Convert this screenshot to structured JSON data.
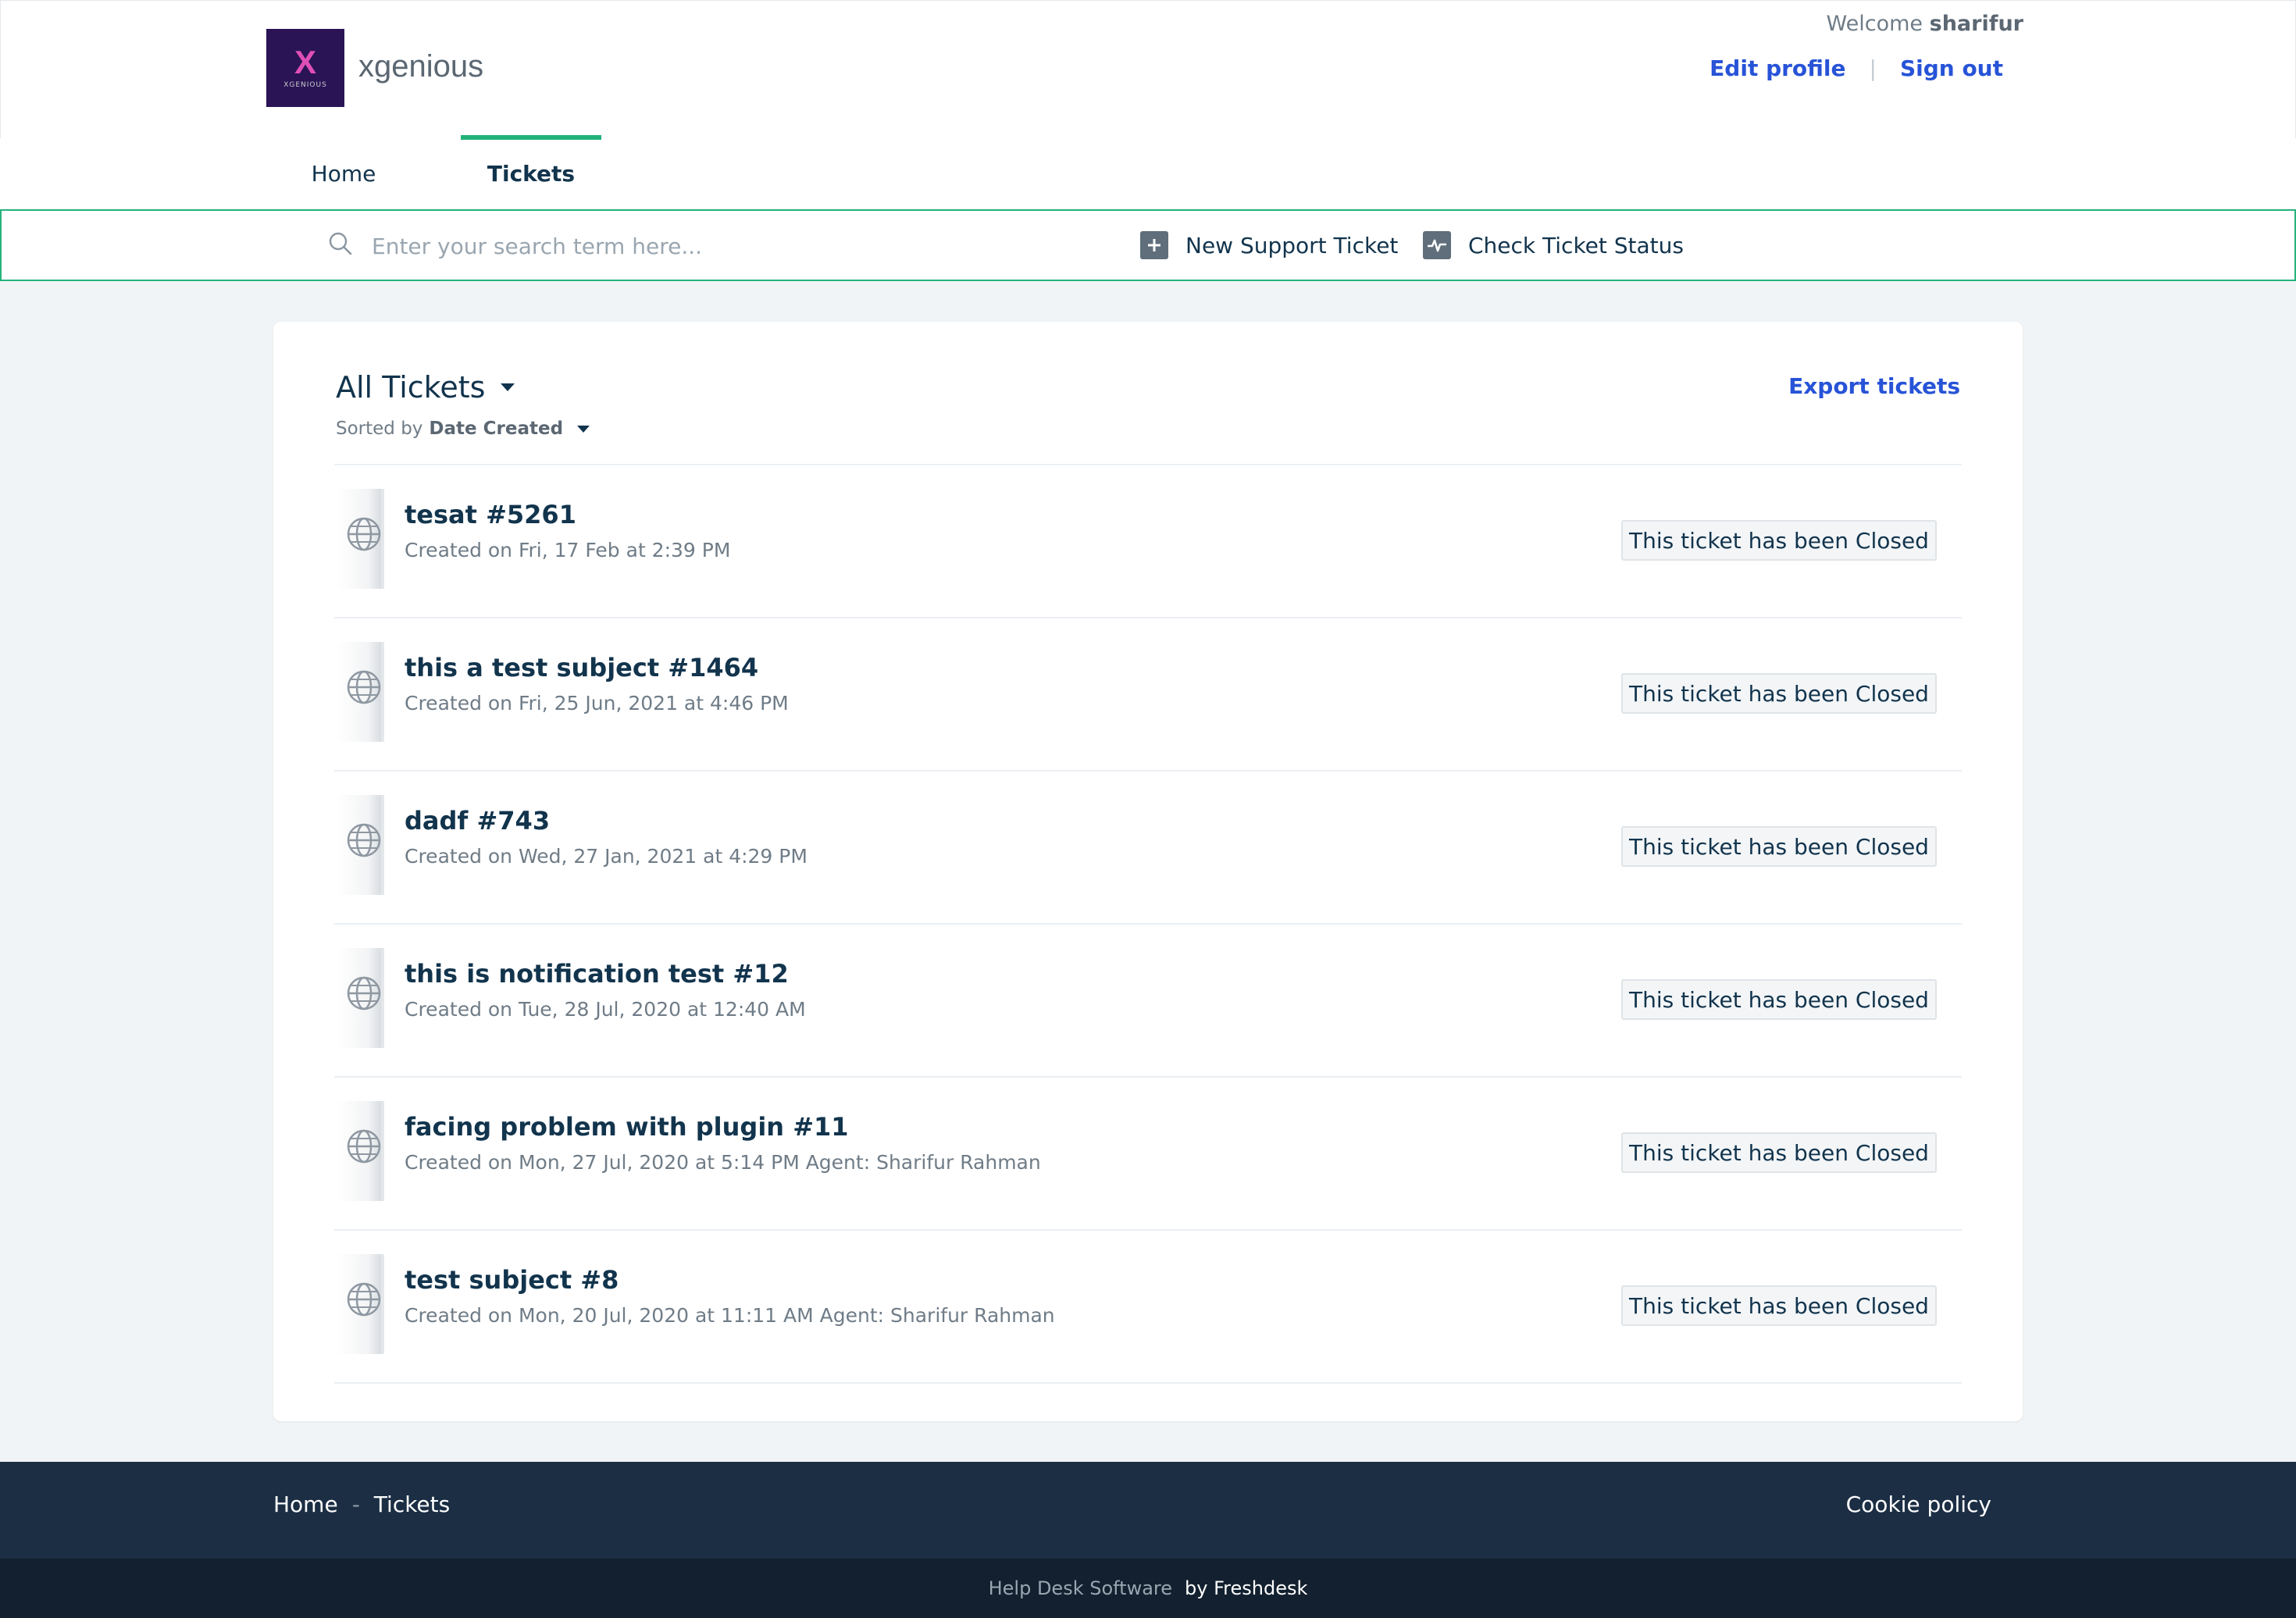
{
  "header": {
    "brand_name": "xgenious",
    "logo_text": "XGENIOUS",
    "welcome_prefix": "Welcome",
    "username": "sharifur",
    "edit_profile": "Edit profile",
    "separator": "|",
    "sign_out": "Sign out"
  },
  "nav": {
    "tabs": [
      {
        "label": "Home",
        "active": false
      },
      {
        "label": "Tickets",
        "active": true
      }
    ]
  },
  "search": {
    "placeholder": "Enter your search term here...",
    "new_ticket": "New Support Ticket",
    "check_status": "Check Ticket Status"
  },
  "tickets": {
    "filter_label": "All Tickets",
    "sorted_prefix": "Sorted by",
    "sorted_value": "Date Created",
    "export_label": "Export tickets",
    "items": [
      {
        "title": "tesat #5261",
        "meta": "Created on Fri, 17 Feb at 2:39 PM",
        "status": "This ticket has been Closed"
      },
      {
        "title": "this a test subject #1464",
        "meta": "Created on Fri, 25 Jun, 2021 at 4:46 PM",
        "status": "This ticket has been Closed"
      },
      {
        "title": "dadf #743",
        "meta": "Created on Wed, 27 Jan, 2021 at 4:29 PM",
        "status": "This ticket has been Closed"
      },
      {
        "title": "this is notification test #12",
        "meta": "Created on Tue, 28 Jul, 2020 at 12:40 AM",
        "status": "This ticket has been Closed"
      },
      {
        "title": "facing problem with plugin #11",
        "meta": "Created on Mon, 27 Jul, 2020 at 5:14 PM Agent: Sharifur Rahman",
        "status": "This ticket has been Closed"
      },
      {
        "title": "test subject #8",
        "meta": "Created on Mon, 20 Jul, 2020 at 11:11 AM Agent: Sharifur Rahman",
        "status": "This ticket has been Closed"
      }
    ]
  },
  "footer": {
    "home": "Home",
    "dash": "-",
    "tickets": "Tickets",
    "cookie_policy": "Cookie policy",
    "helpdesk": "Help Desk Software",
    "by": "by Freshdesk"
  },
  "colors": {
    "accent_green": "#21b27a",
    "link_blue": "#2753d7",
    "footer_dark": "#1b2e44",
    "footer_darker": "#12202f",
    "logo_bg": "#2a1456"
  },
  "icons": [
    "search-icon",
    "plus-square-icon",
    "activity-icon",
    "globe-icon",
    "caret-down-icon"
  ]
}
